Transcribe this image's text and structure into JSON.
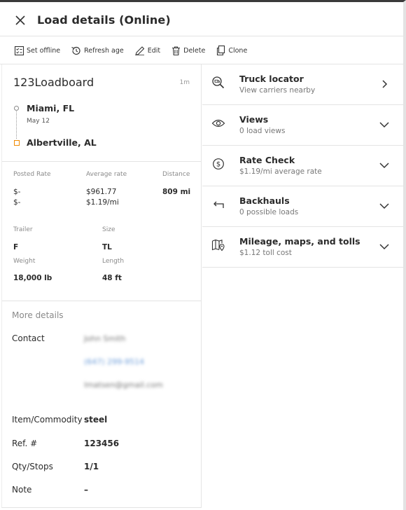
{
  "header": {
    "title": "Load details (Online)"
  },
  "toolbar": {
    "set_offline": "Set offline",
    "refresh_age": "Refresh age",
    "edit": "Edit",
    "delete": "Delete",
    "clone": "Clone"
  },
  "load": {
    "board": "123Loadboard",
    "age": "1m",
    "origin_city": "Miami, FL",
    "origin_date": "May 12",
    "destination_city": "Albertville, AL",
    "rates": {
      "posted_label": "Posted Rate",
      "average_label": "Average rate",
      "distance_label": "Distance",
      "posted_total": "$-",
      "posted_per_mile": "$-",
      "average_total": "$961.77",
      "average_per_mile": "$1.19/mi",
      "distance": "809 mi"
    },
    "equipment": {
      "trailer_label": "Trailer",
      "size_label": "Size",
      "trailer": "F",
      "size": "TL",
      "weight_label": "Weight",
      "length_label": "Length",
      "weight": "18,000 lb",
      "length": "48 ft"
    }
  },
  "more_details": {
    "title": "More details",
    "contact_label": "Contact",
    "contact_name": "John Smith",
    "contact_phone": "(647) 299-9514",
    "contact_email": "lmatsen@gmail.com",
    "commodity_label": "Item/Commodity",
    "commodity": "steel",
    "ref_label": "Ref. #",
    "ref": "123456",
    "qty_label": "Qty/Stops",
    "qty": "1/1",
    "note_label": "Note",
    "note": "–"
  },
  "panels": [
    {
      "title": "Truck locator",
      "subtitle": "View carriers nearby",
      "icon": "truck-search-icon",
      "chevron": "chevron-right"
    },
    {
      "title": "Views",
      "subtitle": "0 load views",
      "icon": "eye-icon",
      "chevron": "chevron-down"
    },
    {
      "title": "Rate Check",
      "subtitle": "$1.19/mi average rate",
      "icon": "dollar-circle-icon",
      "chevron": "chevron-down"
    },
    {
      "title": "Backhauls",
      "subtitle": "0 possible loads",
      "icon": "return-arrow-icon",
      "chevron": "chevron-down"
    },
    {
      "title": "Mileage, maps, and tolls",
      "subtitle": "$1.12 toll cost",
      "icon": "map-pin-icon",
      "chevron": "chevron-down"
    }
  ],
  "colors": {
    "accent_orange": "#f08a00",
    "link_blue": "#6a9bd8",
    "text": "#2b2b2b",
    "muted": "#8a8a8a"
  }
}
